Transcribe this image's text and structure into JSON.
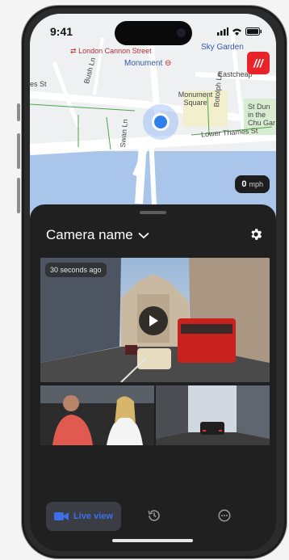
{
  "status_bar": {
    "time": "9:41"
  },
  "map": {
    "labels": {
      "london_cannon_street": "London Cannon Street",
      "monument_station": "Monument",
      "sky_garden": "Sky Garden",
      "eastcheap": "Eastcheap",
      "monument_square": "Monument Square",
      "botolph_ln": "Botolph Ln",
      "st_dunstan": "St Dun in the Chu Gar",
      "lower_thames_st": "Lower Thames St",
      "swan_ln": "Swan Ln",
      "bush_ln": "Bush Ln",
      "es_st": "es St"
    },
    "speed": {
      "value": "0",
      "unit": "mph"
    }
  },
  "brand": {
    "logo_text": "///",
    "color": "#e8232a"
  },
  "sheet": {
    "camera_name": "Camera name",
    "video_badge": "30 seconds ago"
  },
  "nav": {
    "live_view_label": "Live view"
  },
  "colors": {
    "accent": "#3f6fe8",
    "pin": "#2f80ed"
  },
  "icons": [
    "chevron-down-icon",
    "gear-icon",
    "play-icon",
    "video-camera-icon",
    "history-icon",
    "more-icon",
    "signal-icon",
    "wifi-icon",
    "battery-icon",
    "rail-icon",
    "underground-icon"
  ]
}
